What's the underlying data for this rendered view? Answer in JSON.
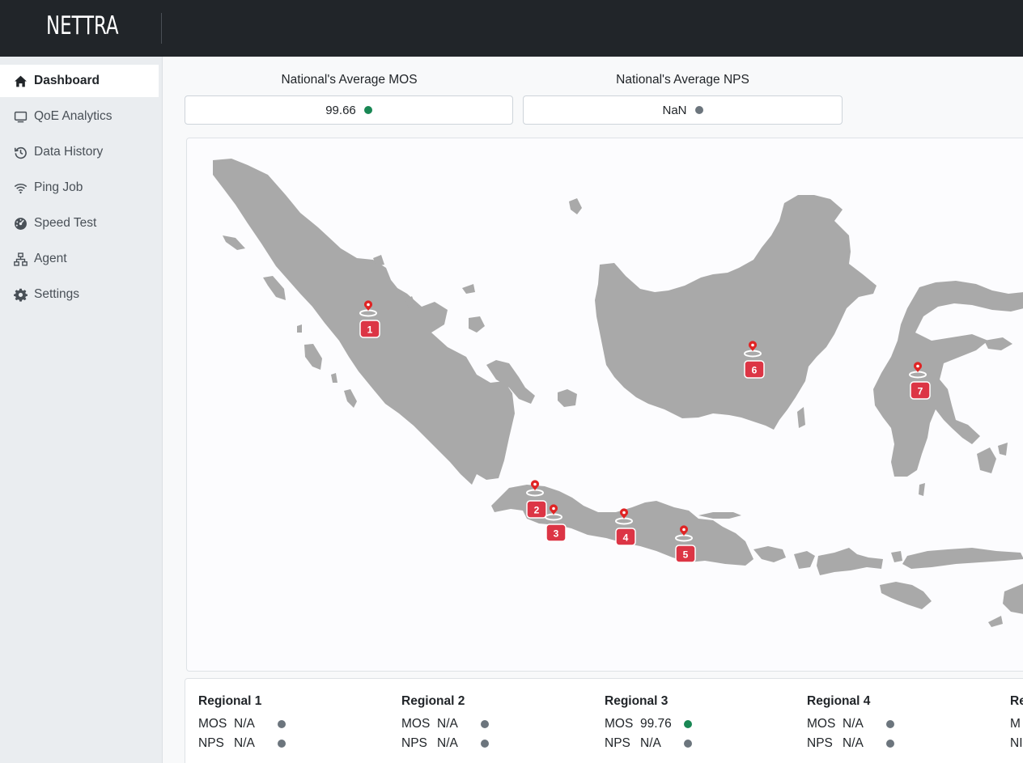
{
  "app": {
    "brand": "NETTRA"
  },
  "sidebar": {
    "items": [
      {
        "label": "Dashboard",
        "icon": "home-icon",
        "active": true
      },
      {
        "label": "QoE Analytics",
        "icon": "monitor-icon",
        "active": false
      },
      {
        "label": "Data History",
        "icon": "history-icon",
        "active": false
      },
      {
        "label": "Ping Job",
        "icon": "wifi-icon",
        "active": false
      },
      {
        "label": "Speed Test",
        "icon": "gauge-icon",
        "active": false
      },
      {
        "label": "Agent",
        "icon": "network-icon",
        "active": false
      },
      {
        "label": "Settings",
        "icon": "gear-icon",
        "active": false
      }
    ]
  },
  "kpis": {
    "mos": {
      "label": "National's Average MOS",
      "value": "99.66",
      "status_color": "#198754"
    },
    "nps": {
      "label": "National's Average NPS",
      "value": "NaN",
      "status_color": "#6c757d"
    }
  },
  "map": {
    "markers": [
      "1",
      "2",
      "3",
      "4",
      "5",
      "6",
      "7"
    ],
    "marker_color": "#dc3545",
    "land_color": "#a9a9a9"
  },
  "regions": [
    {
      "title": "Regional 1",
      "mos_label": "MOS",
      "mos": "N/A",
      "mos_color": "#6c757d",
      "nps_label": "NPS",
      "nps": "N/A",
      "nps_color": "#6c757d"
    },
    {
      "title": "Regional 2",
      "mos_label": "MOS",
      "mos": "N/A",
      "mos_color": "#6c757d",
      "nps_label": "NPS",
      "nps": "N/A",
      "nps_color": "#6c757d"
    },
    {
      "title": "Regional 3",
      "mos_label": "MOS",
      "mos": "99.76",
      "mos_color": "#198754",
      "nps_label": "NPS",
      "nps": "N/A",
      "nps_color": "#6c757d"
    },
    {
      "title": "Regional 4",
      "mos_label": "MOS",
      "mos": "N/A",
      "mos_color": "#6c757d",
      "nps_label": "NPS",
      "nps": "N/A",
      "nps_color": "#6c757d"
    },
    {
      "title": "Re",
      "mos_label": "M",
      "mos": "",
      "mos_color": "",
      "nps_label": "NI",
      "nps": "",
      "nps_color": ""
    }
  ]
}
